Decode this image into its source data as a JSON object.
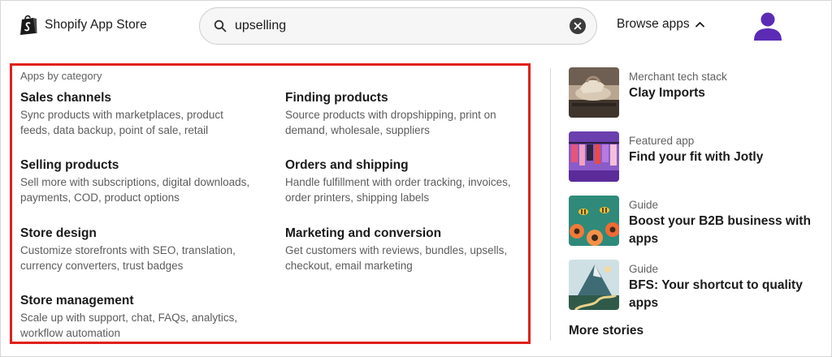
{
  "header": {
    "logo_text": "Shopify App Store",
    "search": {
      "value": "upselling"
    },
    "browse_label": "Browse apps"
  },
  "categories": {
    "heading": "Apps by category",
    "items": [
      {
        "title": "Sales channels",
        "desc_line1": "Sync products with marketplaces, product",
        "desc_line2": "feeds, data backup, point of sale, retail"
      },
      {
        "title": "Finding products",
        "desc_line1": "Source products with dropshipping, print on",
        "desc_line2": "demand, wholesale, suppliers"
      },
      {
        "title": "Selling products",
        "desc_line1": "Sell more with subscriptions, digital downloads,",
        "desc_line2": "payments, COD, product options"
      },
      {
        "title": "Orders and shipping",
        "desc_line1": "Handle fulfillment with order tracking, invoices,",
        "desc_line2": "order printers, shipping labels"
      },
      {
        "title": "Store design",
        "desc_line1": "Customize storefronts with SEO, translation,",
        "desc_line2": "currency converters, trust badges"
      },
      {
        "title": "Marketing and conversion",
        "desc_line1": "Get customers with reviews, bundles, upsells,",
        "desc_line2": "checkout, email marketing"
      },
      {
        "title": "Store management",
        "desc_line1": "Scale up with support, chat, FAQs, analytics,",
        "desc_line2": "workflow automation"
      }
    ]
  },
  "stories": {
    "items": [
      {
        "label": "Merchant tech stack",
        "title_line1": "Clay Imports",
        "title_line2": ""
      },
      {
        "label": "Featured app",
        "title_line1": "Find your fit with Jotly",
        "title_line2": ""
      },
      {
        "label": "Guide",
        "title_line1": "Boost your B2B business with",
        "title_line2": "apps"
      },
      {
        "label": "Guide",
        "title_line1": "BFS: Your shortcut to quality",
        "title_line2": "apps"
      }
    ],
    "more_label": "More stories"
  },
  "colors": {
    "highlight_border": "#e0201b",
    "avatar": "#5b2bb5",
    "shopify_bag": "#1a1a1a"
  },
  "icons": {
    "logo": "shopify-bag-icon",
    "search": "search-icon",
    "clear": "close-icon",
    "browse": "chevron-up-icon",
    "avatar": "user-avatar-icon"
  }
}
